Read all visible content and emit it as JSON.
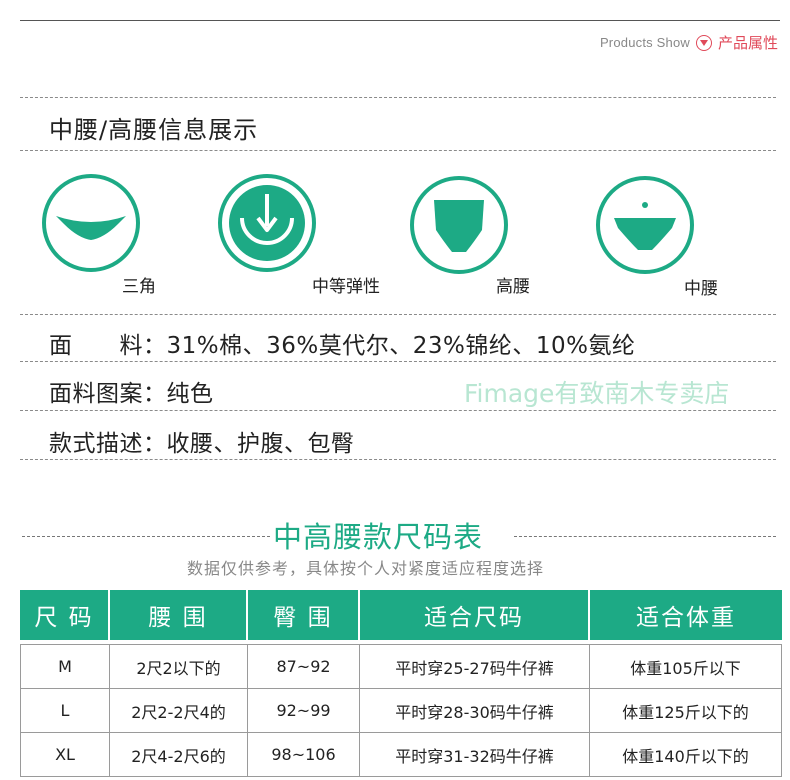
{
  "header": {
    "products_show_label": "Products  Show",
    "attribute_label": "产品属性",
    "accent_color": "#e04a5a"
  },
  "waist_section": {
    "title": "中腰/高腰信息展示",
    "icons": [
      {
        "label": "三角",
        "icon": "triangle-brief-icon"
      },
      {
        "label": "中等弹性",
        "icon": "medium-elasticity-icon"
      },
      {
        "label": "高腰",
        "icon": "high-waist-icon"
      },
      {
        "label": "中腰",
        "icon": "mid-waist-icon"
      }
    ],
    "brand_color": "#1daa85"
  },
  "attributes": {
    "fabric_label": "面　　料：",
    "fabric_value": "31%棉、36%莫代尔、23%锦纶、10%氨纶",
    "pattern_label": "面料图案：",
    "pattern_value": "纯色",
    "style_label": "款式描述：",
    "style_value": "收腰、护腹、包臀",
    "watermark": "Fimage有致南木专卖店"
  },
  "size_chart": {
    "title": "中高腰款尺码表",
    "subtitle": "数据仅供参考，具体按个人对紧度适应程度选择",
    "headers": [
      "尺 码",
      "腰 围",
      "臀 围",
      "适合尺码",
      "适合体重"
    ],
    "rows": [
      [
        "M",
        "2尺2以下的",
        "87~92",
        "平时穿25-27码牛仔裤",
        "体重105斤以下"
      ],
      [
        "L",
        "2尺2-2尺4的",
        "92~99",
        "平时穿28-30码牛仔裤",
        "体重125斤以下的"
      ],
      [
        "XL",
        "2尺4-2尺6的",
        "98~106",
        "平时穿31-32码牛仔裤",
        "体重140斤以下的"
      ]
    ]
  }
}
